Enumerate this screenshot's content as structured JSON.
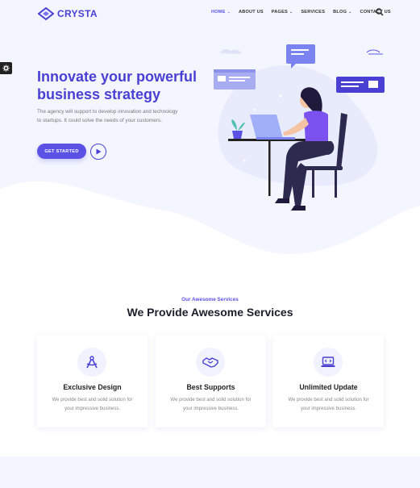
{
  "brand": {
    "name": "CRYSTA"
  },
  "nav": {
    "items": [
      {
        "label": "HOME",
        "has_caret": true,
        "active": true
      },
      {
        "label": "ABOUT US",
        "has_caret": false
      },
      {
        "label": "PAGES",
        "has_caret": true
      },
      {
        "label": "SERVICES",
        "has_caret": false
      },
      {
        "label": "BLOG",
        "has_caret": true
      },
      {
        "label": "CONTACT US",
        "has_caret": false
      }
    ],
    "search_icon": "search-icon"
  },
  "hero": {
    "title": "Innovate your powerful business strategy",
    "description": "The agency will support to develop innovation and technology to startups. It could solve the needs of your customers.",
    "cta_label": "GET STARTED",
    "play_icon": "play-icon"
  },
  "services": {
    "subtitle": "Our Awesome Services",
    "title": "We Provide Awesome Services",
    "cards": [
      {
        "icon": "design-compass-icon",
        "title": "Exclusive Design",
        "desc": "We provide best and solid solution for your impressive business."
      },
      {
        "icon": "handshake-icon",
        "title": "Best Supports",
        "desc": "We provide best and solid solution for your impressive business."
      },
      {
        "icon": "laptop-code-icon",
        "title": "Unlimited Update",
        "desc": "We provide best and solid solution for your impressive business."
      }
    ]
  },
  "colors": {
    "accent": "#5b52e5",
    "accent_dark": "#4a3fd3",
    "hero_bg": "#f3f6fe"
  }
}
